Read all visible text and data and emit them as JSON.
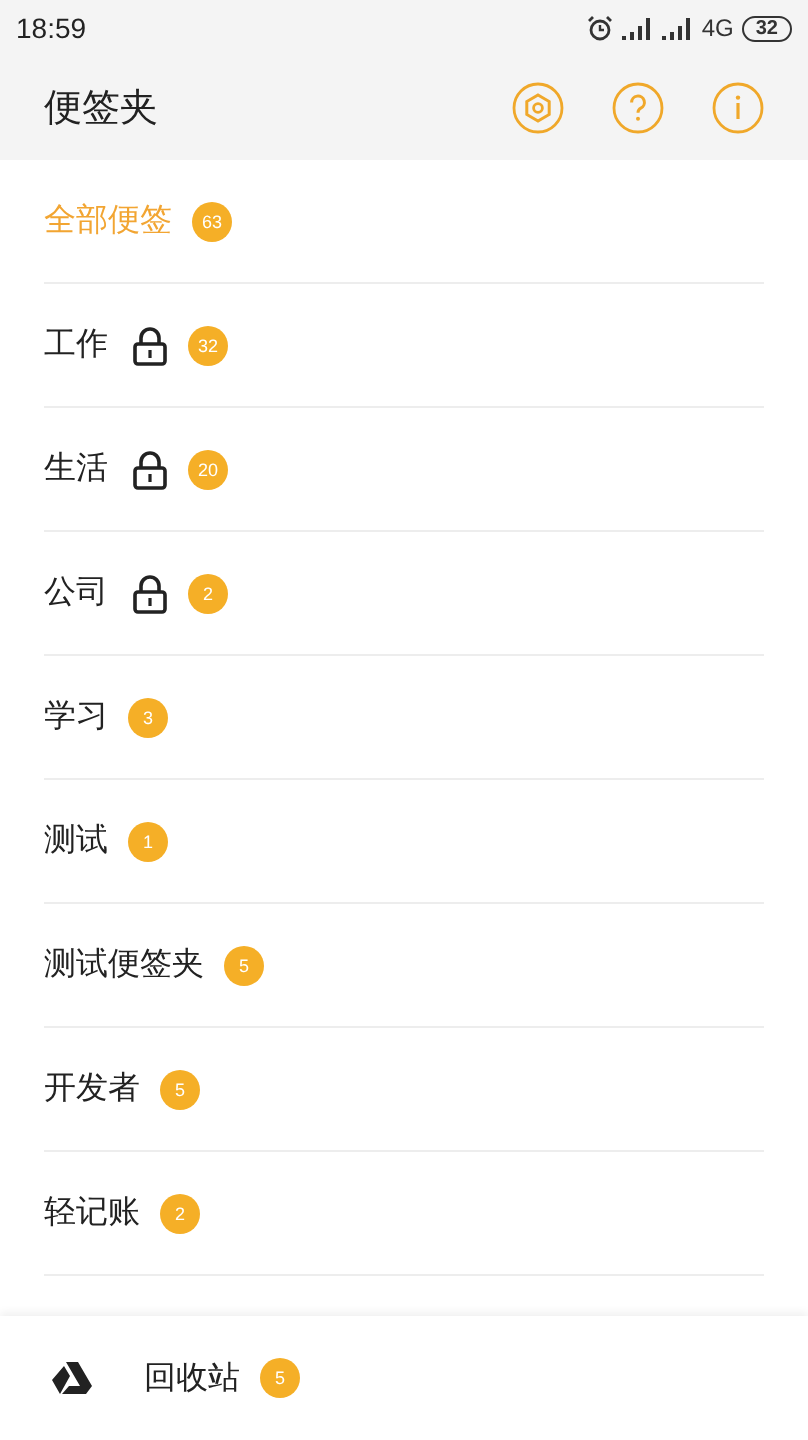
{
  "status_bar": {
    "time": "18:59",
    "network": "4G",
    "battery": "32"
  },
  "header": {
    "title": "便签夹"
  },
  "folders": [
    {
      "name": "全部便签",
      "count": "63",
      "locked": false,
      "selected": true
    },
    {
      "name": "工作",
      "count": "32",
      "locked": true,
      "selected": false
    },
    {
      "name": "生活",
      "count": "20",
      "locked": true,
      "selected": false
    },
    {
      "name": "公司",
      "count": "2",
      "locked": true,
      "selected": false
    },
    {
      "name": "学习",
      "count": "3",
      "locked": false,
      "selected": false
    },
    {
      "name": "测试",
      "count": "1",
      "locked": false,
      "selected": false
    },
    {
      "name": "测试便签夹",
      "count": "5",
      "locked": false,
      "selected": false
    },
    {
      "name": "开发者",
      "count": "5",
      "locked": false,
      "selected": false
    },
    {
      "name": "轻记账",
      "count": "2",
      "locked": false,
      "selected": false
    }
  ],
  "trash": {
    "label": "回收站",
    "count": "5"
  }
}
